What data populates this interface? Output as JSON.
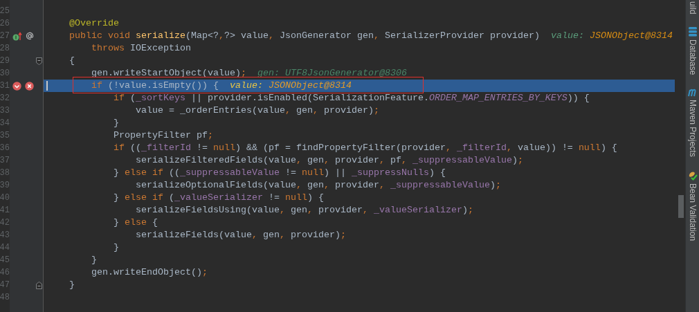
{
  "editor": {
    "lines": [
      {
        "number": "25"
      },
      {
        "number": "26",
        "tokens": [
          {
            "kind": "annotation",
            "text": "@Override"
          }
        ]
      },
      {
        "number": "27",
        "gutter": [
          {
            "kind": "implemented"
          },
          {
            "kind": "annotation"
          }
        ],
        "tokens": [
          {
            "kind": "keyword",
            "text": "public void "
          },
          {
            "kind": "method",
            "text": "serialize"
          },
          {
            "kind": "plain",
            "text": "(Map<?"
          },
          {
            "kind": "keyword",
            "text": ","
          },
          {
            "kind": "plain",
            "text": "?> value"
          },
          {
            "kind": "keyword",
            "text": ", "
          },
          {
            "kind": "plain",
            "text": "JsonGenerator gen"
          },
          {
            "kind": "keyword",
            "text": ", "
          },
          {
            "kind": "plain",
            "text": "SerializerProvider provider)"
          }
        ],
        "hint": {
          "kind": "fresh",
          "label": "value:",
          "value": "JSONObject@8314"
        }
      },
      {
        "number": "28",
        "tokens": [
          {
            "kind": "keyword",
            "text": "    throws "
          },
          {
            "kind": "plain",
            "text": "IOException"
          }
        ]
      },
      {
        "number": "29",
        "gutter": [
          {
            "kind": "fold-start"
          }
        ],
        "tokens": [
          {
            "kind": "plain",
            "text": "{"
          }
        ]
      },
      {
        "number": "30",
        "tokens": [
          {
            "kind": "plain",
            "text": "    gen.writeStartObject(value)"
          },
          {
            "kind": "keyword",
            "text": ";"
          }
        ],
        "hint": {
          "kind": "stale",
          "label": "gen:",
          "value": "UTF8JsonGenerator@8306"
        }
      },
      {
        "number": "31",
        "current": true,
        "gutter": [
          {
            "kind": "breakpoint"
          },
          {
            "kind": "error"
          }
        ],
        "tokens": [
          {
            "kind": "keyword",
            "text": "    if "
          },
          {
            "kind": "plain",
            "text": "(!value.isEmpty()) {"
          }
        ],
        "hint": {
          "kind": "fresh",
          "label": "value:",
          "value": "JSONObject@8314"
        }
      },
      {
        "number": "32",
        "tokens": [
          {
            "kind": "keyword",
            "text": "        if "
          },
          {
            "kind": "plain",
            "text": "("
          },
          {
            "kind": "field",
            "text": "_sortKeys"
          },
          {
            "kind": "plain",
            "text": " || provider.isEnabled(SerializationFeature."
          },
          {
            "kind": "constant",
            "text": "ORDER_MAP_ENTRIES_BY_KEYS"
          },
          {
            "kind": "plain",
            "text": ")) {"
          }
        ]
      },
      {
        "number": "33",
        "tokens": [
          {
            "kind": "plain",
            "text": "            value = _orderEntries(value"
          },
          {
            "kind": "keyword",
            "text": ", "
          },
          {
            "kind": "plain",
            "text": "gen"
          },
          {
            "kind": "keyword",
            "text": ", "
          },
          {
            "kind": "plain",
            "text": "provider)"
          },
          {
            "kind": "keyword",
            "text": ";"
          }
        ]
      },
      {
        "number": "34",
        "tokens": [
          {
            "kind": "plain",
            "text": "        }"
          }
        ]
      },
      {
        "number": "35",
        "tokens": [
          {
            "kind": "plain",
            "text": "        PropertyFilter pf"
          },
          {
            "kind": "keyword",
            "text": ";"
          }
        ]
      },
      {
        "number": "36",
        "tokens": [
          {
            "kind": "keyword",
            "text": "        if "
          },
          {
            "kind": "plain",
            "text": "(("
          },
          {
            "kind": "field",
            "text": "_filterId"
          },
          {
            "kind": "plain",
            "text": " != "
          },
          {
            "kind": "keyword",
            "text": "null"
          },
          {
            "kind": "plain",
            "text": ") && (pf = findPropertyFilter(provider"
          },
          {
            "kind": "keyword",
            "text": ", "
          },
          {
            "kind": "field",
            "text": "_filterId"
          },
          {
            "kind": "keyword",
            "text": ", "
          },
          {
            "kind": "plain",
            "text": "value)) != "
          },
          {
            "kind": "keyword",
            "text": "null"
          },
          {
            "kind": "plain",
            "text": ") {"
          }
        ]
      },
      {
        "number": "37",
        "tokens": [
          {
            "kind": "plain",
            "text": "            serializeFilteredFields(value"
          },
          {
            "kind": "keyword",
            "text": ", "
          },
          {
            "kind": "plain",
            "text": "gen"
          },
          {
            "kind": "keyword",
            "text": ", "
          },
          {
            "kind": "plain",
            "text": "provider"
          },
          {
            "kind": "keyword",
            "text": ", "
          },
          {
            "kind": "plain",
            "text": "pf"
          },
          {
            "kind": "keyword",
            "text": ", "
          },
          {
            "kind": "field",
            "text": "_suppressableValue"
          },
          {
            "kind": "plain",
            "text": ")"
          },
          {
            "kind": "keyword",
            "text": ";"
          }
        ]
      },
      {
        "number": "38",
        "tokens": [
          {
            "kind": "plain",
            "text": "        } "
          },
          {
            "kind": "keyword",
            "text": "else if "
          },
          {
            "kind": "plain",
            "text": "(("
          },
          {
            "kind": "field",
            "text": "_suppressableValue"
          },
          {
            "kind": "plain",
            "text": " != "
          },
          {
            "kind": "keyword",
            "text": "null"
          },
          {
            "kind": "plain",
            "text": ") || "
          },
          {
            "kind": "field",
            "text": "_suppressNulls"
          },
          {
            "kind": "plain",
            "text": ") {"
          }
        ]
      },
      {
        "number": "39",
        "tokens": [
          {
            "kind": "plain",
            "text": "            serializeOptionalFields(value"
          },
          {
            "kind": "keyword",
            "text": ", "
          },
          {
            "kind": "plain",
            "text": "gen"
          },
          {
            "kind": "keyword",
            "text": ", "
          },
          {
            "kind": "plain",
            "text": "provider"
          },
          {
            "kind": "keyword",
            "text": ", "
          },
          {
            "kind": "field",
            "text": "_suppressableValue"
          },
          {
            "kind": "plain",
            "text": ")"
          },
          {
            "kind": "keyword",
            "text": ";"
          }
        ]
      },
      {
        "number": "40",
        "tokens": [
          {
            "kind": "plain",
            "text": "        } "
          },
          {
            "kind": "keyword",
            "text": "else if "
          },
          {
            "kind": "plain",
            "text": "("
          },
          {
            "kind": "field",
            "text": "_valueSerializer"
          },
          {
            "kind": "plain",
            "text": " != "
          },
          {
            "kind": "keyword",
            "text": "null"
          },
          {
            "kind": "plain",
            "text": ") {"
          }
        ]
      },
      {
        "number": "41",
        "tokens": [
          {
            "kind": "plain",
            "text": "            serializeFieldsUsing(value"
          },
          {
            "kind": "keyword",
            "text": ", "
          },
          {
            "kind": "plain",
            "text": "gen"
          },
          {
            "kind": "keyword",
            "text": ", "
          },
          {
            "kind": "plain",
            "text": "provider"
          },
          {
            "kind": "keyword",
            "text": ", "
          },
          {
            "kind": "field",
            "text": "_valueSerializer"
          },
          {
            "kind": "plain",
            "text": ")"
          },
          {
            "kind": "keyword",
            "text": ";"
          }
        ]
      },
      {
        "number": "42",
        "tokens": [
          {
            "kind": "plain",
            "text": "        } "
          },
          {
            "kind": "keyword",
            "text": "else "
          },
          {
            "kind": "plain",
            "text": "{"
          }
        ]
      },
      {
        "number": "43",
        "tokens": [
          {
            "kind": "plain",
            "text": "            serializeFields(value"
          },
          {
            "kind": "keyword",
            "text": ", "
          },
          {
            "kind": "plain",
            "text": "gen"
          },
          {
            "kind": "keyword",
            "text": ", "
          },
          {
            "kind": "plain",
            "text": "provider)"
          },
          {
            "kind": "keyword",
            "text": ";"
          }
        ]
      },
      {
        "number": "44",
        "tokens": [
          {
            "kind": "plain",
            "text": "        }"
          }
        ]
      },
      {
        "number": "45",
        "tokens": [
          {
            "kind": "plain",
            "text": "    }"
          }
        ]
      },
      {
        "number": "46",
        "tokens": [
          {
            "kind": "plain",
            "text": "    gen.writeEndObject()"
          },
          {
            "kind": "keyword",
            "text": ";"
          }
        ]
      },
      {
        "number": "47",
        "gutter": [
          {
            "kind": "fold-end"
          }
        ],
        "tokens": [
          {
            "kind": "plain",
            "text": "}"
          }
        ]
      },
      {
        "number": "48"
      }
    ]
  },
  "tool_windows": [
    {
      "kind": "build",
      "label": "uild"
    },
    {
      "kind": "database",
      "label": "Database"
    },
    {
      "kind": "maven",
      "label": "Maven Projects"
    },
    {
      "kind": "bean",
      "label": "Bean Validation"
    }
  ]
}
